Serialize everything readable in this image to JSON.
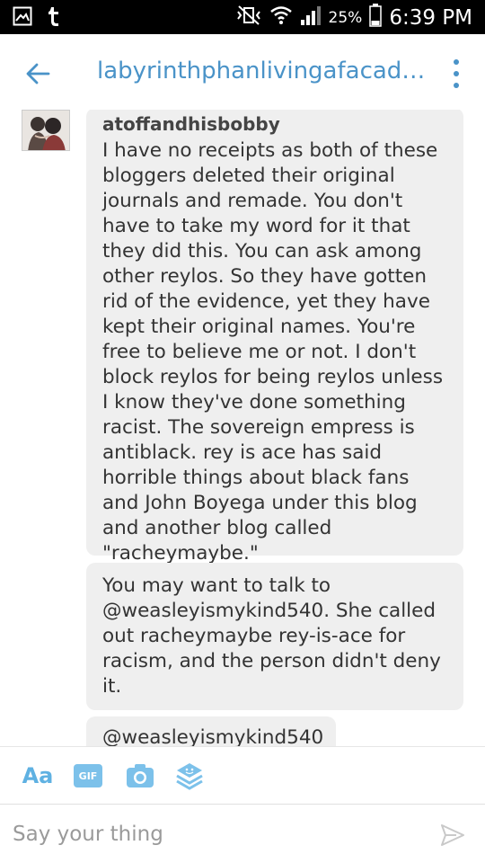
{
  "status_bar": {
    "battery_pct": "25%",
    "time": "6:39 PM",
    "icons": [
      "image-notification-icon",
      "tumblr-icon",
      "mute-vibrate-icon",
      "wifi-icon",
      "signal-icon",
      "battery-icon"
    ]
  },
  "header": {
    "title": "labyrinthphanlivingafacade..."
  },
  "thread": {
    "messages": [
      {
        "sender": "atoffandhisbobby",
        "text": "I have no receipts as both of these bloggers deleted their original journals and remade. You don't have to take my word for it that they did this. You can ask among other reylos. So they have gotten rid of the evidence, yet they have kept their original names. You're free to believe me or not. I don't block reylos for being reylos unless I know they've done something racist. The sovereign empress is antiblack. rey is ace has said horrible things about black fans and John Boyega under this blog and another blog called \"racheymaybe.\""
      },
      {
        "text": "You may want to talk to @weasleyismykind540. She called out racheymaybe rey-is-ace for racism, and the person didn't deny it."
      },
      {
        "text": "@weasleyismykind540"
      }
    ]
  },
  "composer": {
    "tools": {
      "text_label": "Aa",
      "gif_label": "GIF"
    },
    "placeholder": "Say your thing",
    "value": ""
  },
  "colors": {
    "accent": "#4a93c8",
    "tool_accent": "#5fb1e2",
    "bubble_bg": "#efefef"
  }
}
